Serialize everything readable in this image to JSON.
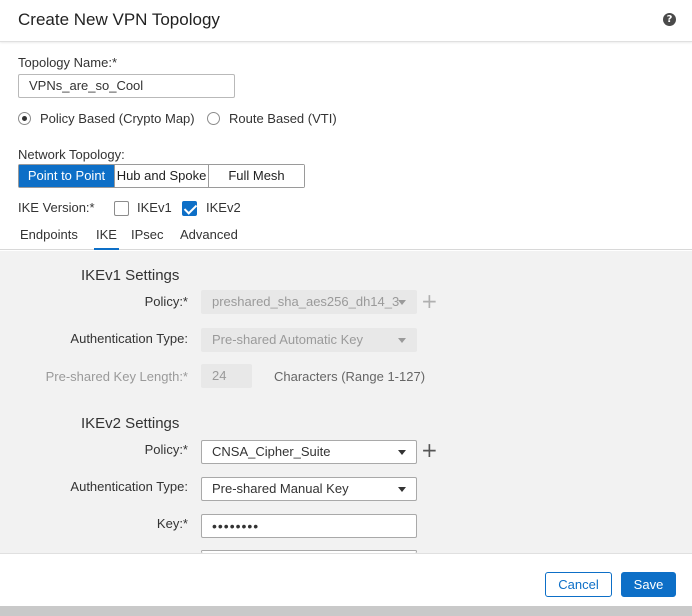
{
  "dialog": {
    "title": "Create New VPN Topology",
    "help_icon": "?"
  },
  "form": {
    "topology_name_label": "Topology Name:*",
    "topology_name_value": "VPNs_are_so_Cool",
    "policy_based_label": "Policy Based (Crypto Map)",
    "route_based_label": "Route Based (VTI)",
    "policy_based_selected": true,
    "network_topology_label": "Network Topology:",
    "topology_options": [
      "Point to Point",
      "Hub and Spoke",
      "Full Mesh"
    ],
    "topology_selected": "Point to Point",
    "ike_version_label": "IKE Version:*",
    "ikev1_label": "IKEv1",
    "ikev2_label": "IKEv2",
    "ikev1_checked": false,
    "ikev2_checked": true
  },
  "tabs": [
    "Endpoints",
    "IKE",
    "IPsec",
    "Advanced"
  ],
  "active_tab": "IKE",
  "ikev1": {
    "title": "IKEv1 Settings",
    "policy_label": "Policy:*",
    "policy_value": "preshared_sha_aes256_dh14_3",
    "auth_label": "Authentication Type:",
    "auth_value": "Pre-shared Automatic Key",
    "key_length_label": "Pre-shared Key Length:*",
    "key_length_value": "24",
    "key_length_hint": "Characters  (Range 1-127)"
  },
  "ikev2": {
    "title": "IKEv2 Settings",
    "policy_label": "Policy:*",
    "policy_value": "CNSA_Cipher_Suite",
    "auth_label": "Authentication Type:",
    "auth_value": "Pre-shared Manual Key",
    "key_label": "Key:*",
    "key_value": "••••••••"
  },
  "footer": {
    "cancel_label": "Cancel",
    "save_label": "Save"
  },
  "colors": {
    "accent": "#0d6fc7",
    "panel_bg": "#f2f2f2"
  }
}
